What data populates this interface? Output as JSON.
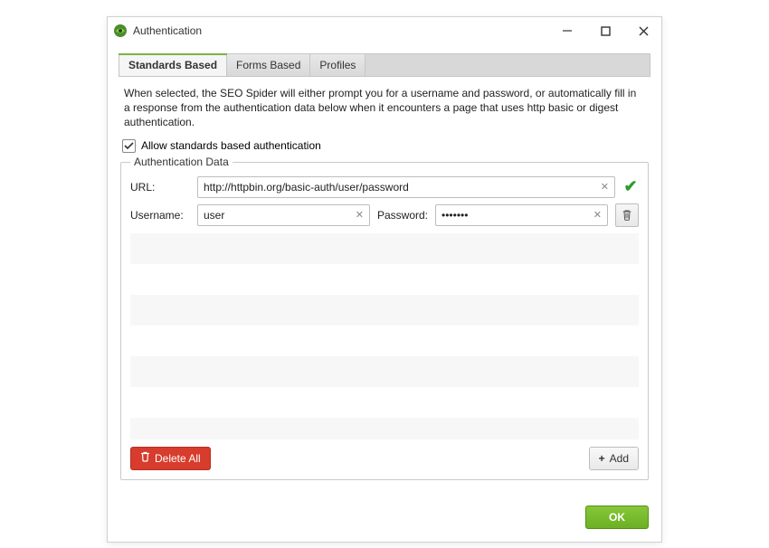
{
  "window": {
    "title": "Authentication"
  },
  "tabs": {
    "standards": "Standards Based",
    "forms": "Forms Based",
    "profiles": "Profiles"
  },
  "description": "When selected, the SEO Spider will either prompt you for a username and password, or automatically fill in a response from the authentication data below when it encounters a page that uses http basic or digest authentication.",
  "allow": {
    "label": "Allow standards based authentication"
  },
  "fieldset": {
    "legend": "Authentication Data"
  },
  "row": {
    "url_label": "URL:",
    "url_value": "http://httpbin.org/basic-auth/user/password",
    "username_label": "Username:",
    "username_value": "user",
    "password_label": "Password:",
    "password_value": "•••••••"
  },
  "buttons": {
    "delete_all": "Delete All",
    "add": "Add",
    "ok": "OK"
  }
}
